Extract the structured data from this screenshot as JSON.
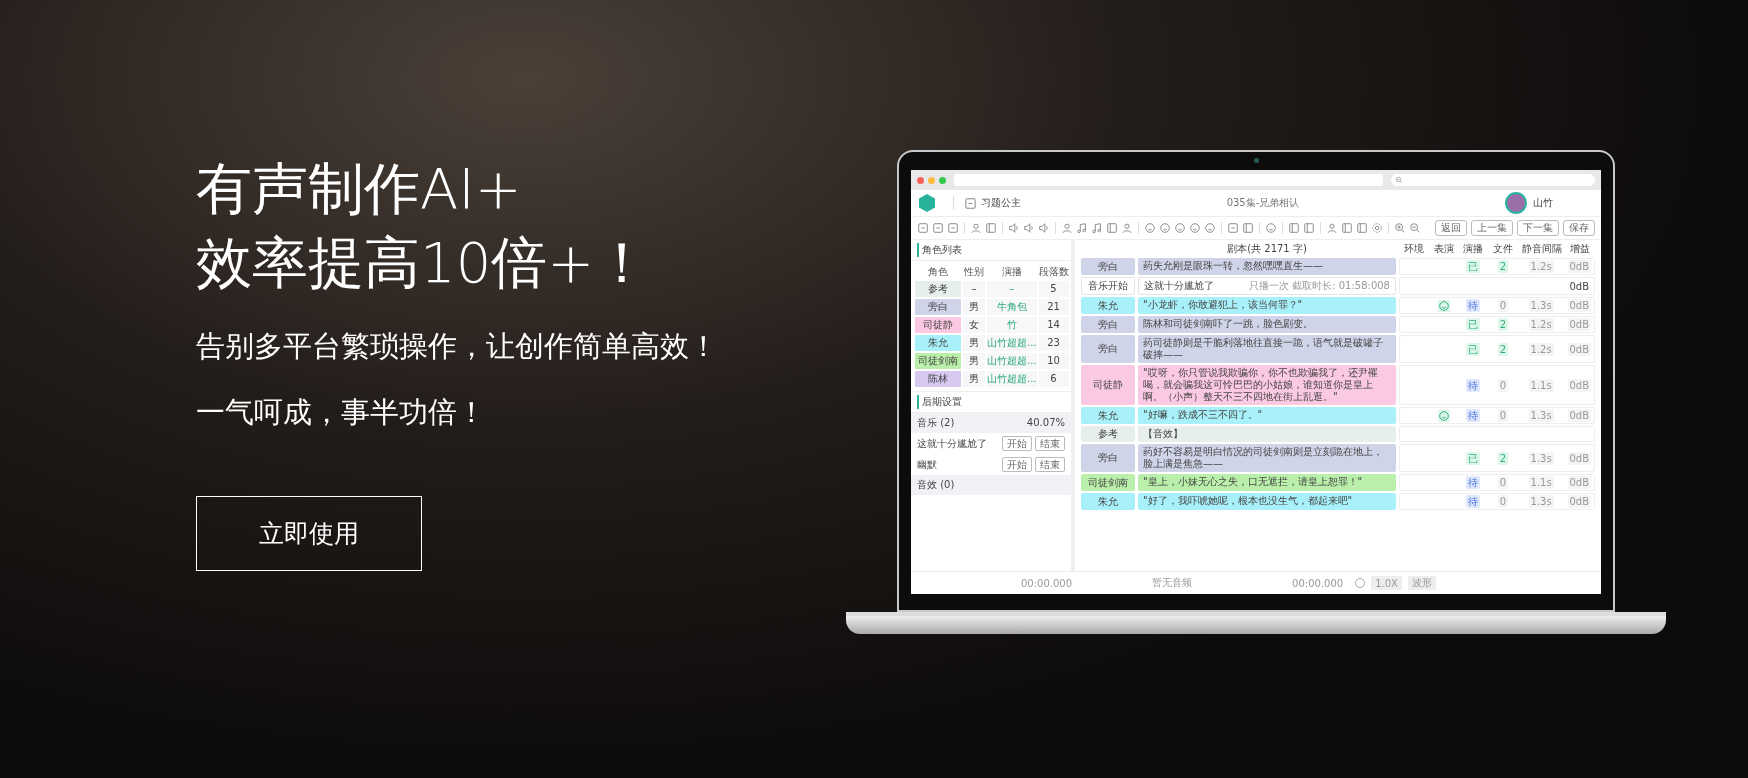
{
  "hero": {
    "title_lines": [
      "有声制作AI+",
      "效率提高10倍+！"
    ],
    "subtitles": [
      "告别多平台繁琐操作，让创作简单高效！",
      "一气呵成，事半功倍！"
    ],
    "cta": "立即使用"
  },
  "app": {
    "project": "习题公主",
    "episode": "035集-兄弟相认",
    "user": "山竹",
    "nav_buttons": [
      "返回",
      "上一集",
      "下一集",
      "保存"
    ],
    "roles_panel": {
      "title": "角色列表",
      "columns": [
        "角色",
        "性别",
        "演播",
        "段落数"
      ],
      "rows": [
        {
          "name": "参考",
          "gender": "–",
          "narrator": "–",
          "count": "5",
          "color": "#e6efe9"
        },
        {
          "name": "旁白",
          "gender": "男",
          "narrator": "牛角包",
          "count": "21",
          "color": "#d0d4e8"
        },
        {
          "name": "司徒静",
          "gender": "女",
          "narrator": "竹",
          "count": "14",
          "color": "#fcc9e4"
        },
        {
          "name": "朱允",
          "gender": "男",
          "narrator": "山竹超超...",
          "count": "23",
          "color": "#a9f1fa"
        },
        {
          "name": "司徒剑南",
          "gender": "男",
          "narrator": "山竹超超...",
          "count": "10",
          "color": "#b9efaa"
        },
        {
          "name": "陈林",
          "gender": "男",
          "narrator": "山竹超超...",
          "count": "6",
          "color": "#d7c8f0"
        }
      ]
    },
    "post_panel": {
      "title": "后期设置",
      "music_label": "音乐 (2)",
      "music_percent": "40.07%",
      "music_items": [
        {
          "name": "这就十分尴尬了",
          "start": "开始",
          "end": "结束"
        },
        {
          "name": "幽默",
          "start": "开始",
          "end": "结束"
        }
      ],
      "effects_label": "音效 (0)"
    },
    "script": {
      "title": "剧本(共 2171 字)",
      "columns": [
        "环境",
        "表演",
        "演播",
        "文件",
        "静音间隔",
        "增益"
      ],
      "rows": [
        {
          "kind": "line",
          "role": "旁白",
          "color": "#d0d4e8",
          "text": "药失允刚是眼珠一转，忽然嘿嘿直生——",
          "performance": false,
          "status": "已",
          "recorded": true,
          "files": "2",
          "silence": "1.2s",
          "gain": "0dB"
        },
        {
          "kind": "music",
          "role": "音乐开始",
          "text": "这就十分尴尬了",
          "note": "只播一次  截取时长: 01:58:008",
          "gain": "0dB"
        },
        {
          "kind": "line",
          "role": "朱允",
          "color": "#a9f1fa",
          "text": "\"小龙虾，你敢避犯上，该当何罪？\"",
          "performance": true,
          "status": "待",
          "recorded": false,
          "files": "0",
          "silence": "1.3s",
          "gain": "0dB"
        },
        {
          "kind": "line",
          "role": "旁白",
          "color": "#d0d4e8",
          "text": "陈林和司徒剑南吓了一跳，脸色剧变。",
          "performance": false,
          "status": "已",
          "recorded": true,
          "files": "2",
          "silence": "1.2s",
          "gain": "0dB"
        },
        {
          "kind": "line",
          "role": "旁白",
          "color": "#d0d4e8",
          "text": "药司徒静则是干脆利落地往直接一跪，语气就是破罐子破摔——",
          "performance": false,
          "status": "已",
          "recorded": true,
          "files": "2",
          "silence": "1.2s",
          "gain": "0dB"
        },
        {
          "kind": "line",
          "role": "司徒静",
          "color": "#fcc9e4",
          "text": "\"哎呀，你只管说我欺骗你，你不也欺骗我了，还尹罹喝，就会骗我这可怜巴巴的小姑娘，谁知道你是皇上啊。（小声）整天不三不四地在街上乱逛。\"",
          "performance": false,
          "status": "待",
          "recorded": false,
          "files": "0",
          "silence": "1.1s",
          "gain": "0dB"
        },
        {
          "kind": "line",
          "role": "朱允",
          "color": "#a9f1fa",
          "text": "\"好嘛，跌成不三不四了。\"",
          "performance": true,
          "status": "待",
          "recorded": false,
          "files": "0",
          "silence": "1.3s",
          "gain": "0dB"
        },
        {
          "kind": "reference",
          "role": "参考",
          "color": "#e6efe9",
          "text": "【音效】"
        },
        {
          "kind": "line",
          "role": "旁白",
          "color": "#d0d4e8",
          "text": "药好不容易是明白情况的司徒剑南则是立刻跪在地上，脸上满是焦急——",
          "performance": false,
          "status": "已",
          "recorded": true,
          "files": "2",
          "silence": "1.3s",
          "gain": "0dB"
        },
        {
          "kind": "line",
          "role": "司徒剑南",
          "color": "#b9efaa",
          "text": "\"皇上，小妹无心之失，口无遮拦，请皇上恕罪！\"",
          "performance": false,
          "status": "待",
          "recorded": false,
          "files": "0",
          "silence": "1.1s",
          "gain": "0dB"
        },
        {
          "kind": "line",
          "role": "朱允",
          "color": "#a9f1fa",
          "text": "\"好了，我吓唬她呢，根本也没生气，都起来吧\"",
          "performance": false,
          "status": "待",
          "recorded": false,
          "files": "0",
          "silence": "1.3s",
          "gain": "0dB"
        }
      ]
    },
    "player": {
      "time_start": "00:00.000",
      "audio": "暂无音频",
      "time_end": "00:00.000",
      "speed": "1.0X",
      "waveform": "波形"
    }
  }
}
